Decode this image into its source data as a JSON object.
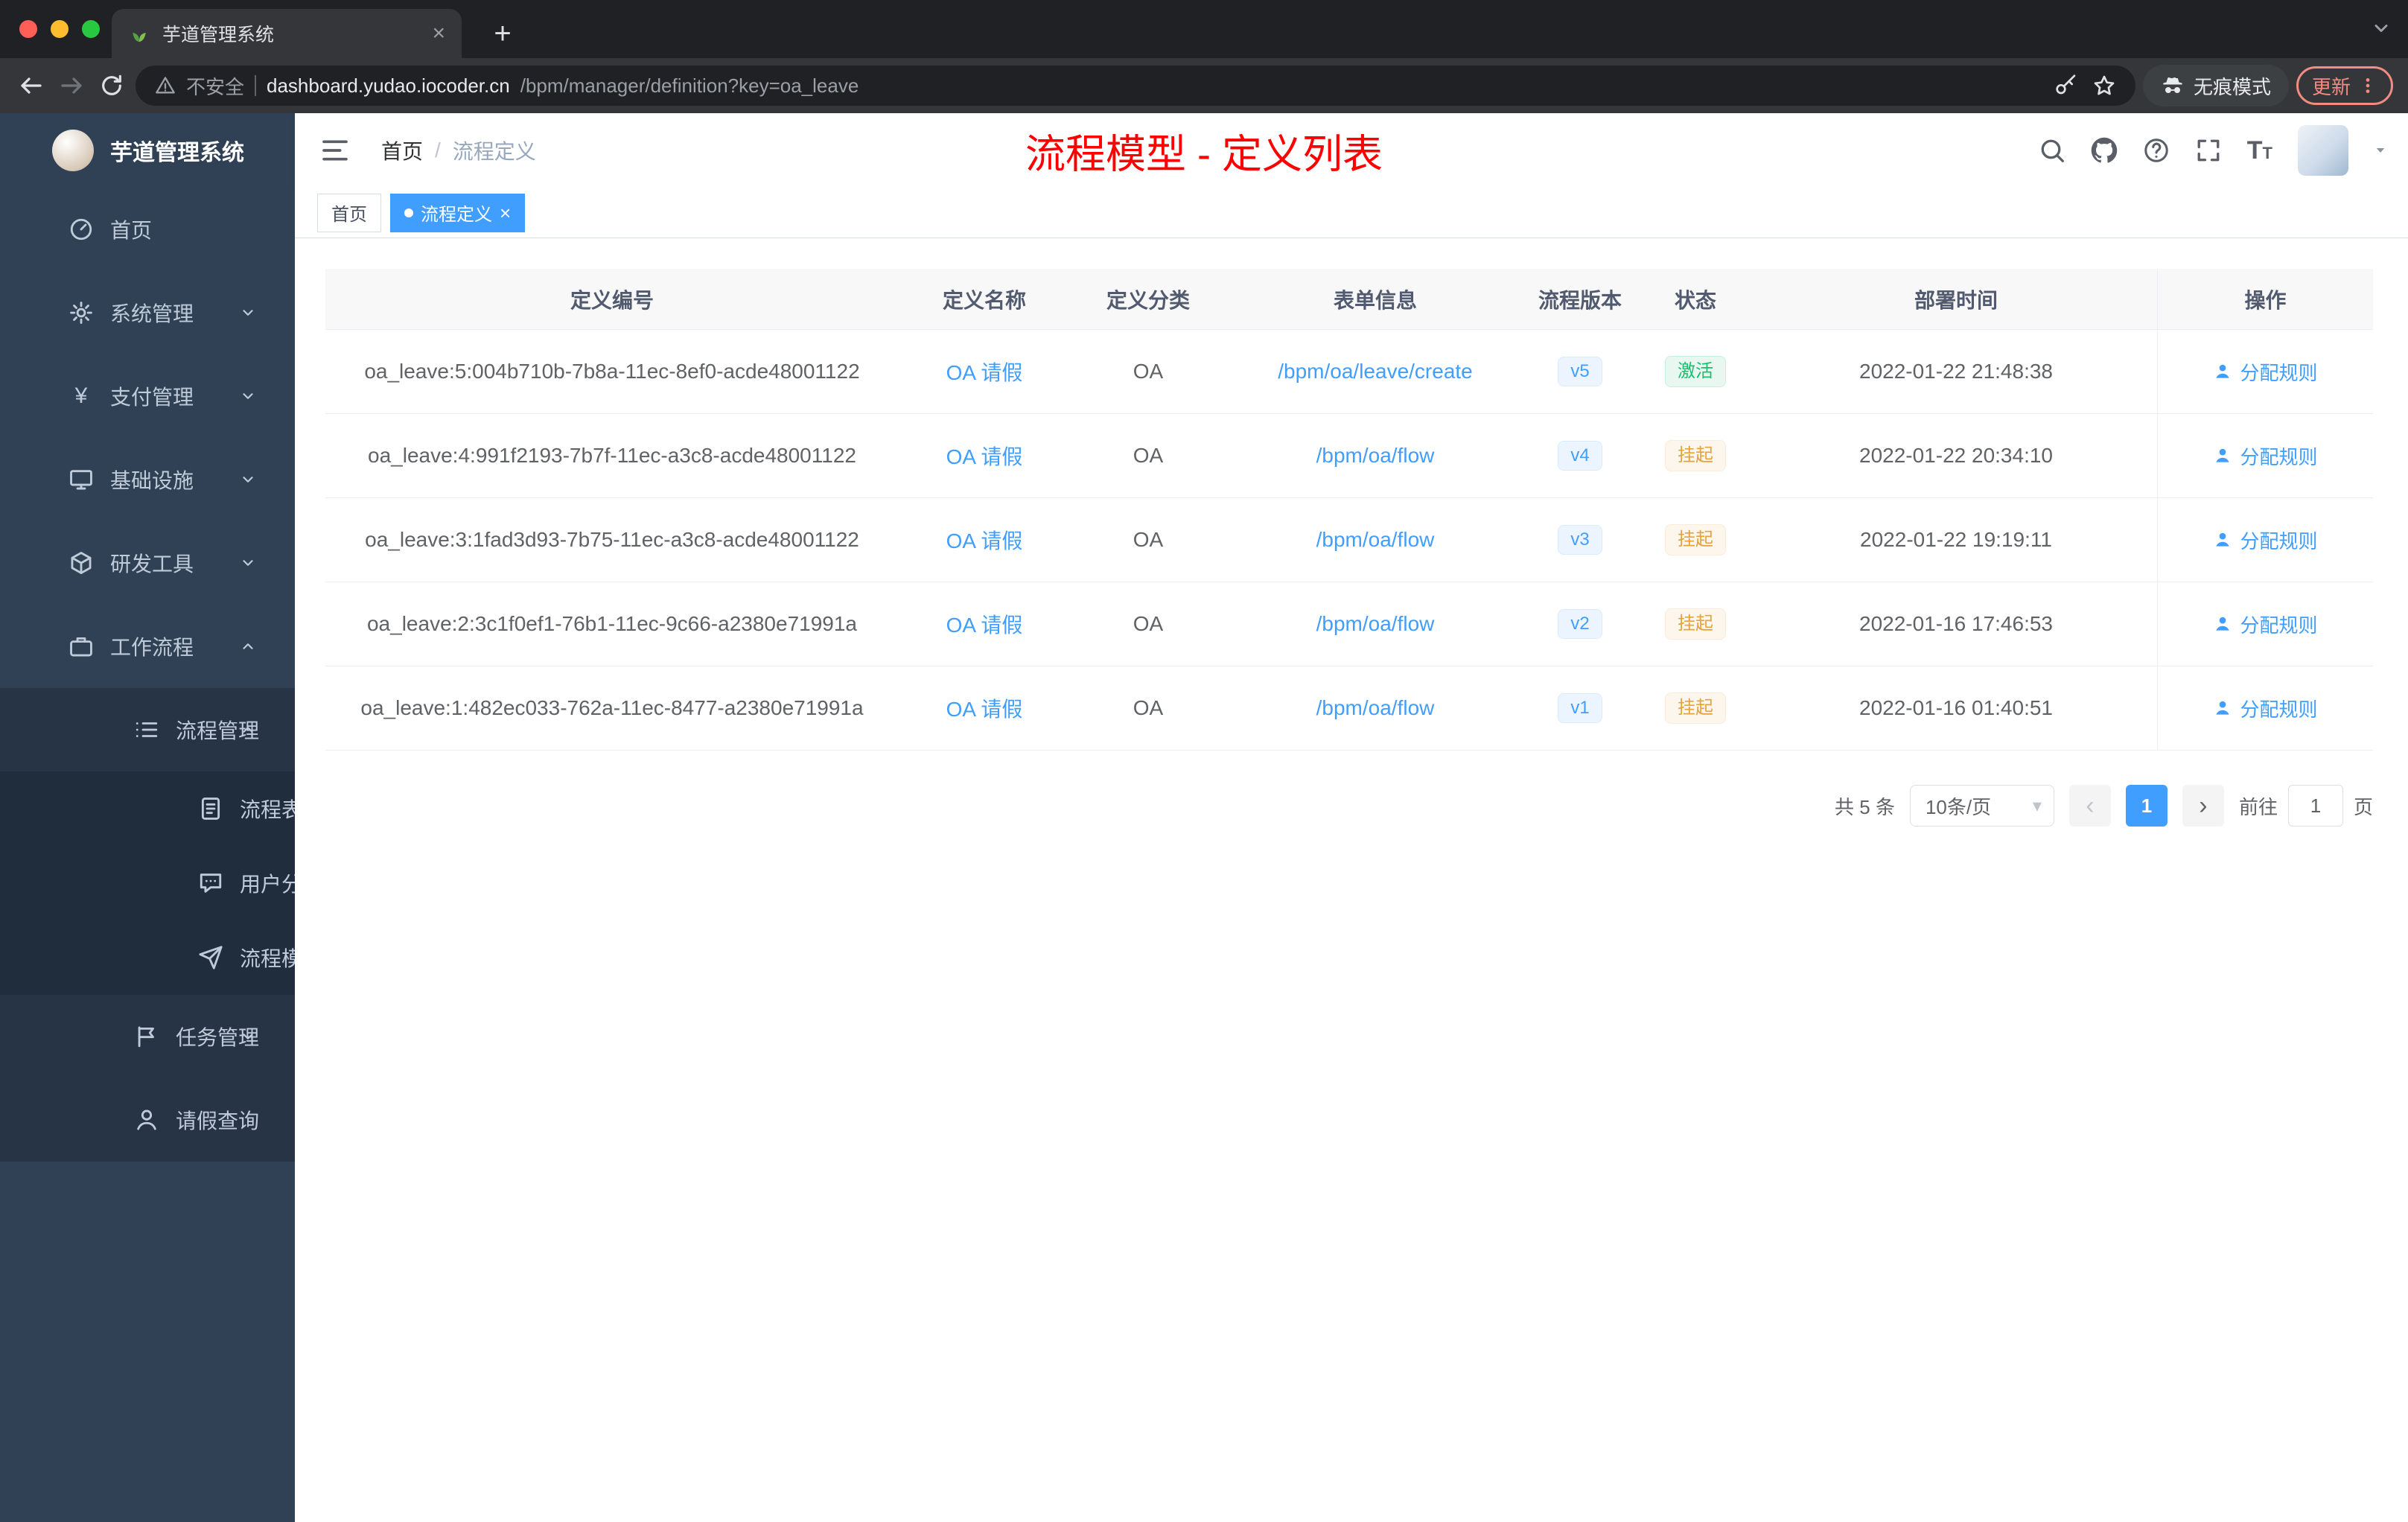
{
  "colors": {
    "accent": "#409eff",
    "sidebar_bg": "#304156",
    "submenu_bg": "#263445",
    "submenu_deep_bg": "#1f2d3d",
    "sidebar_text": "#bfcbd9",
    "annotation_red": "#fe0000",
    "success_text": "#19be6b",
    "success_bg": "#e8f8f1",
    "warning_text": "#e6a23c",
    "warning_bg": "#fdf6ec",
    "browser_dark": "#202124",
    "toolbar_dark": "#35363a",
    "update_chip": "#f28b82"
  },
  "icons": {
    "close": "×",
    "plus": "+",
    "caret_down": "▾",
    "chevron_left": "‹",
    "chevron_right": "›",
    "yen": "¥"
  },
  "browser": {
    "tab_title": "芋道管理系统",
    "security_label": "不安全",
    "url_domain": "dashboard.yudao.iocoder.cn",
    "url_path": "/bpm/manager/definition?key=oa_leave",
    "incognito_label": "无痕模式",
    "update_label": "更新"
  },
  "sidebar": {
    "app_title": "芋道管理系统",
    "items": [
      {
        "label": "首页",
        "icon": "gauge-icon",
        "level": 1
      },
      {
        "label": "系统管理",
        "icon": "gear-icon",
        "level": 1,
        "chevron": "down"
      },
      {
        "label": "支付管理",
        "icon": "yen-icon",
        "level": 1,
        "chevron": "down"
      },
      {
        "label": "基础设施",
        "icon": "monitor-icon",
        "level": 1,
        "chevron": "down"
      },
      {
        "label": "研发工具",
        "icon": "cube-icon",
        "level": 1,
        "chevron": "down"
      },
      {
        "label": "工作流程",
        "icon": "briefcase-icon",
        "level": 1,
        "chevron": "up"
      },
      {
        "label": "流程管理",
        "icon": "list-icon",
        "level": 2,
        "chevron": "up"
      },
      {
        "label": "流程表单",
        "icon": "form-icon",
        "level": 3
      },
      {
        "label": "用户分组",
        "icon": "chat-icon",
        "level": 3
      },
      {
        "label": "流程模型",
        "icon": "plane-icon",
        "level": 3
      },
      {
        "label": "任务管理",
        "icon": "flag-icon",
        "level": 2,
        "chevron": "down"
      },
      {
        "label": "请假查询",
        "icon": "user-icon",
        "level": 2
      }
    ]
  },
  "navbar": {
    "breadcrumb": [
      "首页",
      "流程定义"
    ],
    "separator": "/",
    "annotation": "流程模型 - 定义列表"
  },
  "tags": {
    "items": [
      {
        "label": "首页",
        "active": false
      },
      {
        "label": "流程定义",
        "active": true
      }
    ]
  },
  "table": {
    "headers": [
      "定义编号",
      "定义名称",
      "定义分类",
      "表单信息",
      "流程版本",
      "状态",
      "部署时间",
      "操作"
    ],
    "rows": [
      {
        "id": "oa_leave:5:004b710b-7b8a-11ec-8ef0-acde48001122",
        "name": "OA 请假",
        "category": "OA",
        "form": "/bpm/oa/leave/create",
        "version": "v5",
        "status": "激活",
        "status_type": "success",
        "time": "2022-01-22 21:48:38",
        "action": "分配规则"
      },
      {
        "id": "oa_leave:4:991f2193-7b7f-11ec-a3c8-acde48001122",
        "name": "OA 请假",
        "category": "OA",
        "form": "/bpm/oa/flow",
        "version": "v4",
        "status": "挂起",
        "status_type": "warning",
        "time": "2022-01-22 20:34:10",
        "action": "分配规则"
      },
      {
        "id": "oa_leave:3:1fad3d93-7b75-11ec-a3c8-acde48001122",
        "name": "OA 请假",
        "category": "OA",
        "form": "/bpm/oa/flow",
        "version": "v3",
        "status": "挂起",
        "status_type": "warning",
        "time": "2022-01-22 19:19:11",
        "action": "分配规则"
      },
      {
        "id": "oa_leave:2:3c1f0ef1-76b1-11ec-9c66-a2380e71991a",
        "name": "OA 请假",
        "category": "OA",
        "form": "/bpm/oa/flow",
        "version": "v2",
        "status": "挂起",
        "status_type": "warning",
        "time": "2022-01-16 17:46:53",
        "action": "分配规则"
      },
      {
        "id": "oa_leave:1:482ec033-762a-11ec-8477-a2380e71991a",
        "name": "OA 请假",
        "category": "OA",
        "form": "/bpm/oa/flow",
        "version": "v1",
        "status": "挂起",
        "status_type": "warning",
        "time": "2022-01-16 01:40:51",
        "action": "分配规则"
      }
    ]
  },
  "pagination": {
    "total": "共 5 条",
    "page_size": "10条/页",
    "current": "1",
    "goto_prefix": "前往",
    "goto_value": "1",
    "goto_suffix": "页"
  }
}
